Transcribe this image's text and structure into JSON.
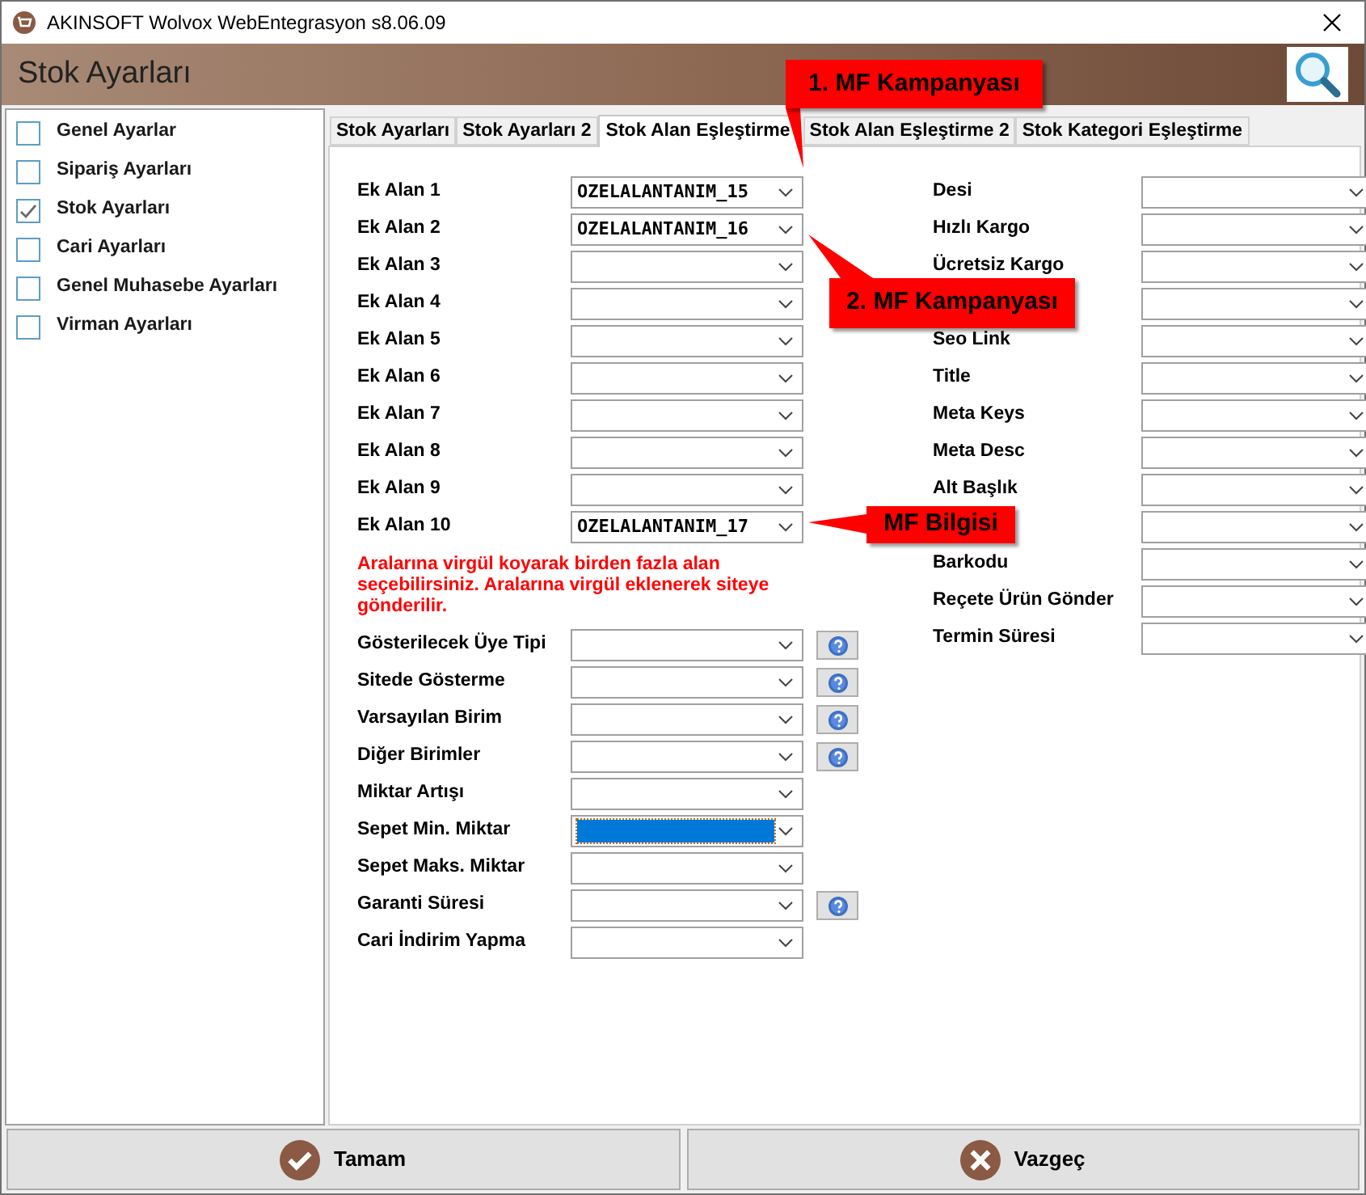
{
  "window": {
    "title": "AKINSOFT Wolvox WebEntegrasyon s8.06.09"
  },
  "header": {
    "title": "Stok Ayarları"
  },
  "sidebar": {
    "items": [
      {
        "label": "Genel Ayarlar",
        "checked": false
      },
      {
        "label": "Sipariş Ayarları",
        "checked": false
      },
      {
        "label": "Stok Ayarları",
        "checked": true
      },
      {
        "label": "Cari Ayarları",
        "checked": false
      },
      {
        "label": "Genel Muhasebe Ayarları",
        "checked": false
      },
      {
        "label": "Virman Ayarları",
        "checked": false
      }
    ]
  },
  "tabs": [
    {
      "label": "Stok Ayarları",
      "selected": false
    },
    {
      "label": "Stok Ayarları 2",
      "selected": false
    },
    {
      "label": "Stok Alan Eşleştirme",
      "selected": true
    },
    {
      "label": "Stok Alan Eşleştirme 2",
      "selected": false
    },
    {
      "label": "Stok Kategori Eşleştirme",
      "selected": false
    }
  ],
  "ek_alan_fields": [
    {
      "label": "Ek Alan 1",
      "value": "OZELALANTANIM_15"
    },
    {
      "label": "Ek Alan 2",
      "value": "OZELALANTANIM_16"
    },
    {
      "label": "Ek Alan 3"
    },
    {
      "label": "Ek Alan 4"
    },
    {
      "label": "Ek Alan 5"
    },
    {
      "label": "Ek Alan 6"
    },
    {
      "label": "Ek Alan 7"
    },
    {
      "label": "Ek Alan 8"
    },
    {
      "label": "Ek Alan 9"
    },
    {
      "label": "Ek Alan 10",
      "value": "OZELALANTANIM_17"
    }
  ],
  "note": "Aralarına virgül koyarak birden fazla alan seçebilirsiniz. Aralarına virgül  eklenerek siteye gönderilir.",
  "lower_fields": [
    {
      "label": "Gösterilecek Üye Tipi",
      "focused": false,
      "help": true
    },
    {
      "label": "Sitede Gösterme",
      "focused": false,
      "help": true
    },
    {
      "label": "Varsayılan Birim",
      "focused": false,
      "help": true
    },
    {
      "label": "Diğer Birimler",
      "focused": false,
      "help": true
    },
    {
      "label": "Miktar Artışı",
      "focused": false,
      "help": false
    },
    {
      "label": "Sepet Min. Miktar",
      "focused": true,
      "help": false
    },
    {
      "label": "Sepet Maks. Miktar",
      "focused": false,
      "help": false
    },
    {
      "label": "Garanti Süresi",
      "focused": false,
      "help": true
    },
    {
      "label": "Cari İndirim Yapma",
      "focused": false,
      "help": false
    }
  ],
  "right_fields": [
    {
      "kind": "labelled",
      "label": "Desi"
    },
    {
      "kind": "labelled",
      "label": "Hızlı Kargo"
    },
    {
      "kind": "labelled",
      "label": "Ücretsiz Kargo"
    },
    {
      "kind": "covered"
    },
    {
      "kind": "labelled",
      "label": "Seo Link"
    },
    {
      "kind": "labelled",
      "label": "Title"
    },
    {
      "kind": "labelled",
      "label": "Meta Keys"
    },
    {
      "kind": "labelled",
      "label": "Meta Desc"
    },
    {
      "kind": "labelled",
      "label": "Alt Başlık"
    },
    {
      "kind": "covered"
    },
    {
      "kind": "labelled",
      "label": "Barkodu"
    },
    {
      "kind": "labelled",
      "label": "Reçete Ürün Gönder"
    },
    {
      "kind": "labelled",
      "label": "Termin Süresi"
    }
  ],
  "callouts": [
    {
      "text": "1. MF Kampanyası"
    },
    {
      "text": "2. MF Kampanyası"
    },
    {
      "text": "MF Bilgisi"
    }
  ],
  "buttons": [
    {
      "label": "Tamam",
      "kind": "ok"
    },
    {
      "label": "Vazgeç",
      "kind": "cancel"
    }
  ]
}
